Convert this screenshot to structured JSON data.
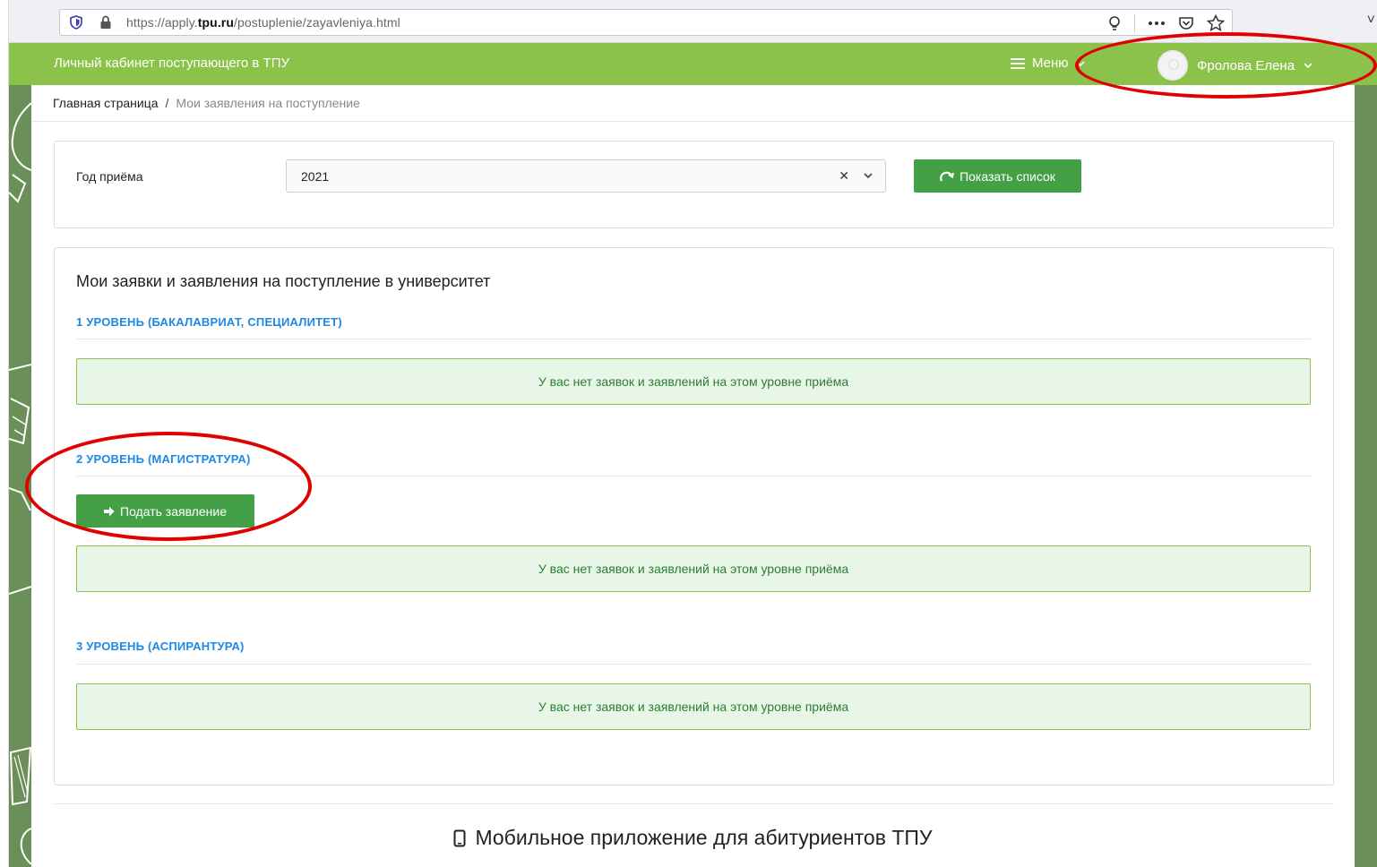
{
  "browser": {
    "url_prefix": "https://apply.",
    "url_domain": "tpu.ru",
    "url_path": "/postuplenie/zayavleniya.html",
    "close_glyph": "˅"
  },
  "header": {
    "app_title": "Личный кабинет поступающего в ТПУ",
    "menu_label": "Меню",
    "user_name": "Фролова Елена"
  },
  "breadcrumb": {
    "home": "Главная страница",
    "separator": "/",
    "current": "Мои заявления на поступление"
  },
  "year_filter": {
    "label": "Год приёма",
    "value": "2021",
    "clear_glyph": "✕",
    "show_button": "Показать список"
  },
  "applications": {
    "title": "Мои заявки и заявления на поступление в университет",
    "levels": [
      {
        "title": "1 УРОВЕНЬ (БАКАЛАВРИАТ, СПЕЦИАЛИТЕТ)",
        "notice": "У вас нет заявок и заявлений на этом уровне приёма"
      },
      {
        "title": "2 УРОВЕНЬ (МАГИСТРАТУРА)",
        "apply_button": "Подать заявление",
        "notice": "У вас нет заявок и заявлений на этом уровне приёма"
      },
      {
        "title": "3 УРОВЕНЬ (АСПИРАНТУРА)",
        "notice": "У вас нет заявок и заявлений на этом уровне приёма"
      }
    ]
  },
  "footer": {
    "mobile_app_title": "Мобильное приложение для абитуриентов ТПУ"
  },
  "colors": {
    "header_green": "#8bc34a",
    "button_green": "#43a047",
    "level_blue": "#1e88e5",
    "highlight_red": "#e00000"
  }
}
